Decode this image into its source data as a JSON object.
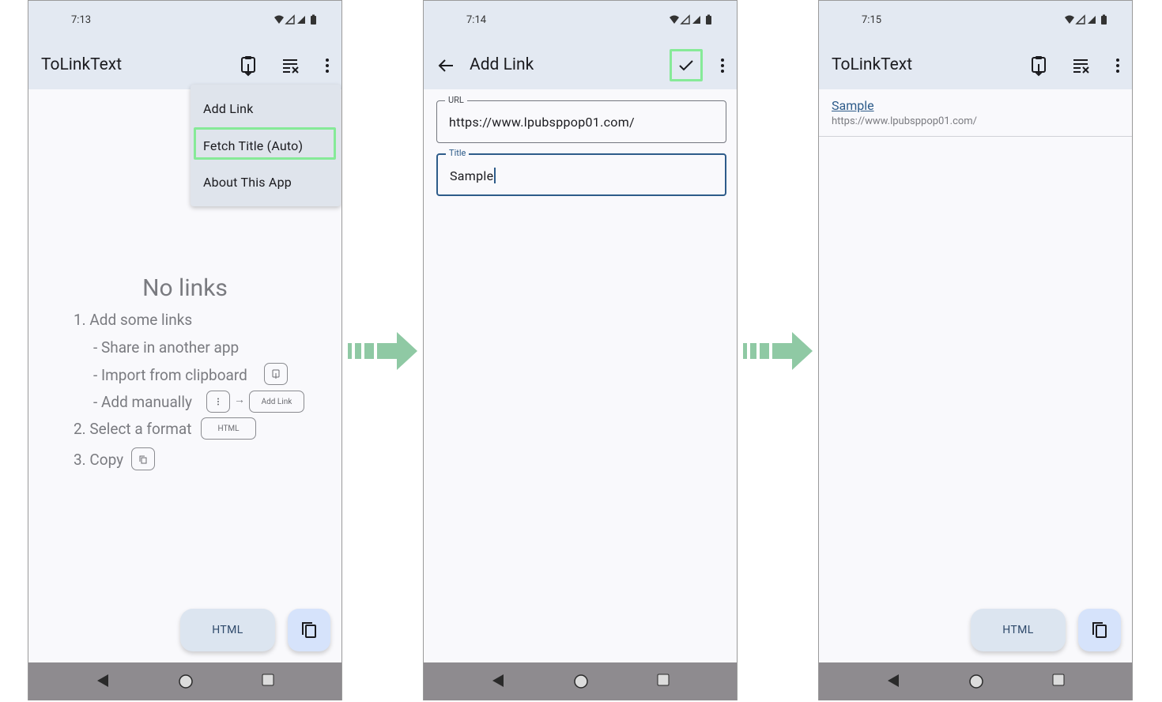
{
  "screen1": {
    "time": "7:13",
    "app_title": "ToLinkText",
    "menu": [
      "Add Link",
      "Fetch Title (Auto)",
      "About This App"
    ],
    "empty_title": "No links",
    "steps": {
      "s1": "1. Add some links",
      "s1a": "-  Share in another app",
      "s1b": "-  Import from clipboard",
      "s1c": "-  Add manually",
      "arrow": "→",
      "add_link_chip": "Add Link",
      "s2": "2. Select a format",
      "html_chip": "HTML",
      "s3": "3. Copy"
    },
    "fab_label": "HTML"
  },
  "screen2": {
    "time": "7:14",
    "title": "Add Link",
    "url_label": "URL",
    "url_value": "https://www.lpubsppop01.com/",
    "title_label": "Title",
    "title_value": "Sample"
  },
  "screen3": {
    "time": "7:15",
    "app_title": "ToLinkText",
    "item_title": "Sample",
    "item_url": "https://www.lpubsppop01.com/",
    "fab_label": "HTML"
  },
  "colors": {
    "appbar": "#e3e9f2",
    "highlight": "#86ea98",
    "flow_arrow": "#8fc9a4",
    "accent": "#2e5c8a"
  }
}
